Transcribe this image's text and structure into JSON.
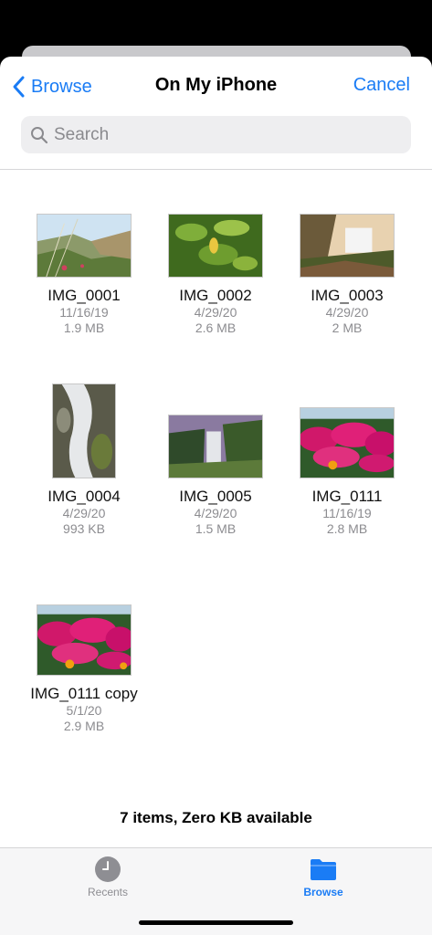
{
  "nav": {
    "back_label": "Browse",
    "title": "On My iPhone",
    "cancel_label": "Cancel"
  },
  "search": {
    "placeholder": "Search"
  },
  "files": [
    {
      "name": "IMG_0001",
      "date": "11/16/19",
      "size": "1.9 MB"
    },
    {
      "name": "IMG_0002",
      "date": "4/29/20",
      "size": "2.6 MB"
    },
    {
      "name": "IMG_0003",
      "date": "4/29/20",
      "size": "2 MB"
    },
    {
      "name": "IMG_0004",
      "date": "4/29/20",
      "size": "993 KB"
    },
    {
      "name": "IMG_0005",
      "date": "4/29/20",
      "size": "1.5 MB"
    },
    {
      "name": "IMG_0111",
      "date": "11/16/19",
      "size": "2.8 MB"
    },
    {
      "name": "IMG_0111 copy",
      "date": "5/1/20",
      "size": "2.9 MB"
    }
  ],
  "footer": {
    "status": "7 items, Zero KB available"
  },
  "tabs": {
    "recents": {
      "label": "Recents",
      "icon": "clock-icon"
    },
    "browse": {
      "label": "Browse",
      "icon": "folder-icon",
      "selected": true
    }
  },
  "colors": {
    "accent": "#1a7cf5",
    "secondary_text": "#8c8c90"
  }
}
